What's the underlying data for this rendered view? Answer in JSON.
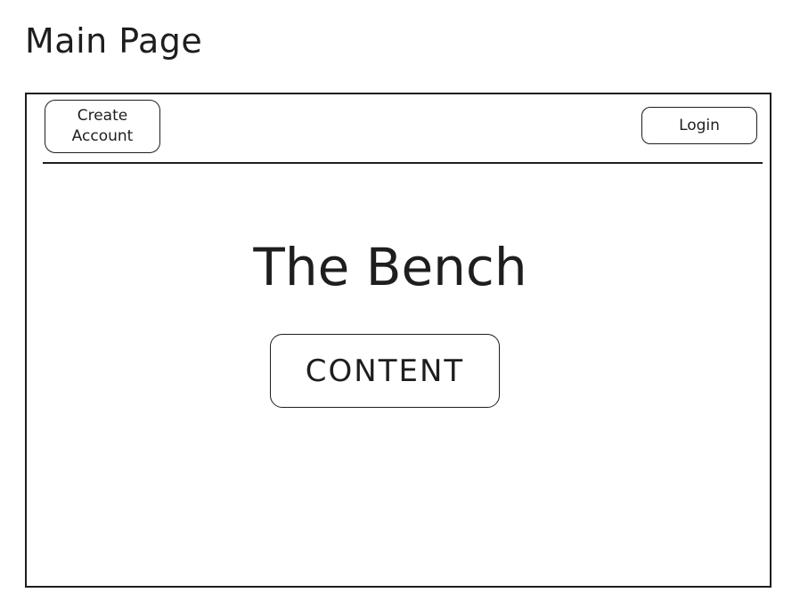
{
  "page": {
    "title": "Main Page"
  },
  "navbar": {
    "create_account_label": "Create\nAccount",
    "login_label": "Login"
  },
  "main": {
    "app_title": "The Bench",
    "content_label": "CONTENT"
  }
}
